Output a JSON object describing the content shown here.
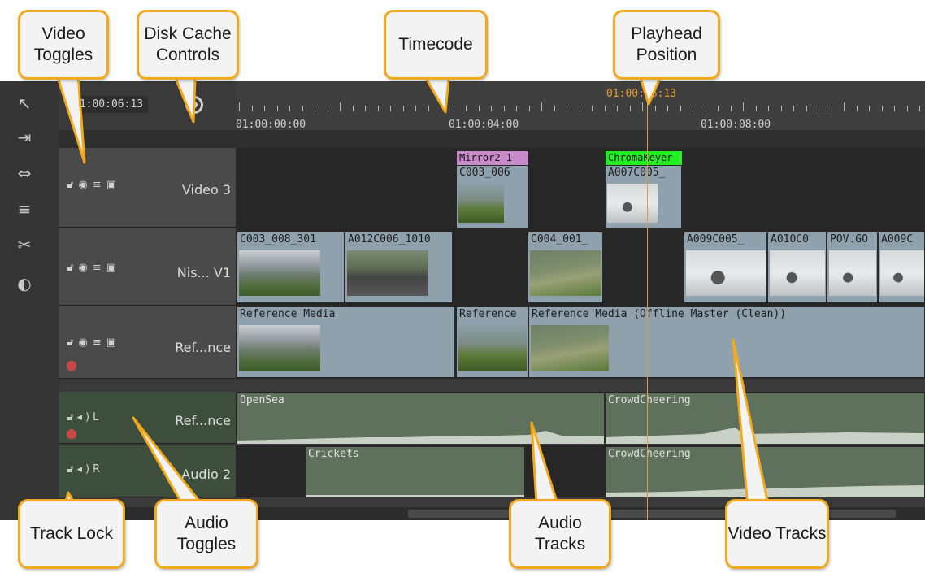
{
  "timecode_readout": "01:00:06:13",
  "playhead_label": "01:00:06:13",
  "ruler": {
    "labels": [
      "01:00:00:00",
      "01:00:04:00",
      "01:00:08:00"
    ]
  },
  "tracks": {
    "video3": {
      "name": "Video 3"
    },
    "v1": {
      "name": "Nis... V1"
    },
    "ref": {
      "name": "Ref...nce"
    },
    "audio1": {
      "name": "Ref...nce",
      "channel": "L"
    },
    "audio2": {
      "name": "Audio 2",
      "channel": "R"
    }
  },
  "clips": {
    "video3": [
      {
        "tag": "Mirror2_1",
        "tag_color": "#c88ac8",
        "name": "C003_006"
      },
      {
        "tag": "ChromaKeyer",
        "tag_color": "#22ee22",
        "name": "A007C005_"
      }
    ],
    "v1": [
      {
        "name": "C003_008_301"
      },
      {
        "name": "A012C006_1010"
      },
      {
        "name": "C004_001_"
      },
      {
        "name": "A009C005_"
      },
      {
        "name": "A010C0"
      },
      {
        "name": "POV.GO"
      },
      {
        "name": "A009C"
      }
    ],
    "ref": [
      {
        "name": "Reference Media"
      },
      {
        "name": "Reference"
      },
      {
        "name": "Reference Media (Offline Master (Clean))"
      }
    ],
    "audio1": [
      {
        "name": "OpenSea"
      },
      {
        "name": "CrowdCheering"
      }
    ],
    "audio2": [
      {
        "name": "Crickets"
      },
      {
        "name": "CrowdCheering"
      }
    ]
  },
  "callouts": {
    "video_toggles": "Video Toggles",
    "disk_cache": "Disk Cache Controls",
    "timecode": "Timecode",
    "playhead": "Playhead Position",
    "track_lock": "Track Lock",
    "audio_toggles": "Audio Toggles",
    "audio_tracks": "Audio Tracks",
    "video_tracks": "Video Tracks"
  },
  "colors": {
    "accent": "#f2a91e",
    "playhead": "#e89a2c",
    "record": "#c84848"
  },
  "icons": [
    "selection-tool-icon",
    "track-select-icon",
    "slip-tool-icon",
    "ripple-tool-icon",
    "razor-tool-icon",
    "multi-view-icon",
    "disk-cache-icon",
    "lock-icon",
    "eye-icon",
    "layers-icon",
    "blend-icon",
    "speaker-icon"
  ]
}
